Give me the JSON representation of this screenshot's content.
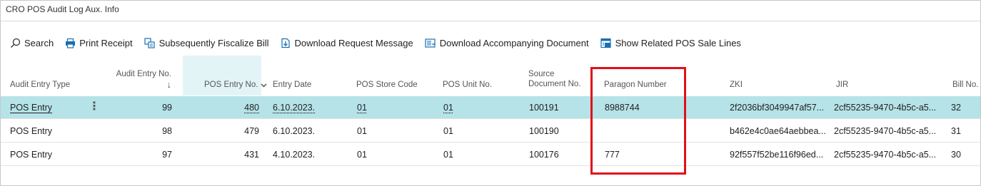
{
  "page_title": "CRO POS Audit Log Aux. Info",
  "toolbar": {
    "items": [
      {
        "label": "Search",
        "icon": "search-icon"
      },
      {
        "label": "Print Receipt",
        "icon": "print-icon"
      },
      {
        "label": "Subsequently Fiscalize Bill",
        "icon": "fiscalize-icon"
      },
      {
        "label": "Download Request Message",
        "icon": "download-document-icon"
      },
      {
        "label": "Download Accompanying Document",
        "icon": "download-list-icon"
      },
      {
        "label": "Show Related POS Sale Lines",
        "icon": "related-lines-icon"
      }
    ]
  },
  "table": {
    "columns": {
      "audit_entry_type": "Audit Entry Type",
      "audit_entry_no": "Audit Entry No.",
      "audit_entry_no_sort": "↓",
      "pos_entry_no": "POS Entry No.",
      "entry_date": "Entry Date",
      "pos_store_code": "POS Store Code",
      "pos_unit_no": "POS Unit No.",
      "source_document_no_line1": "Source",
      "source_document_no_line2": "Document No.",
      "paragon_number": "Paragon Number",
      "zki": "ZKI",
      "jir": "JIR",
      "bill_no": "Bill No."
    },
    "rows": [
      {
        "audit_entry_type": "POS Entry",
        "audit_entry_no": "99",
        "pos_entry_no": "480",
        "entry_date": "6.10.2023.",
        "pos_store_code": "01",
        "pos_unit_no": "01",
        "source_document_no": "100191",
        "paragon_number": "8988744",
        "zki": "2f2036bf3049947af57...",
        "jir": "2cf55235-9470-4b5c-a5...",
        "bill_no": "32"
      },
      {
        "audit_entry_type": "POS Entry",
        "audit_entry_no": "98",
        "pos_entry_no": "479",
        "entry_date": "6.10.2023.",
        "pos_store_code": "01",
        "pos_unit_no": "01",
        "source_document_no": "100190",
        "paragon_number": "",
        "zki": "b462e4c0ae64aebbea...",
        "jir": "2cf55235-9470-4b5c-a5...",
        "bill_no": "31"
      },
      {
        "audit_entry_type": "POS Entry",
        "audit_entry_no": "97",
        "pos_entry_no": "431",
        "entry_date": "4.10.2023.",
        "pos_store_code": "01",
        "pos_unit_no": "01",
        "source_document_no": "100176",
        "paragon_number": "777",
        "zki": "92f557f52be116f96ed...",
        "jir": "2cf55235-9470-4b5c-a5...",
        "bill_no": "30"
      }
    ]
  },
  "colors": {
    "selected_row": "#b5e3e8",
    "sorted_column_header": "#e2f4f6",
    "highlight_box": "#e0101a",
    "icon_accent": "#1a6fb3"
  }
}
